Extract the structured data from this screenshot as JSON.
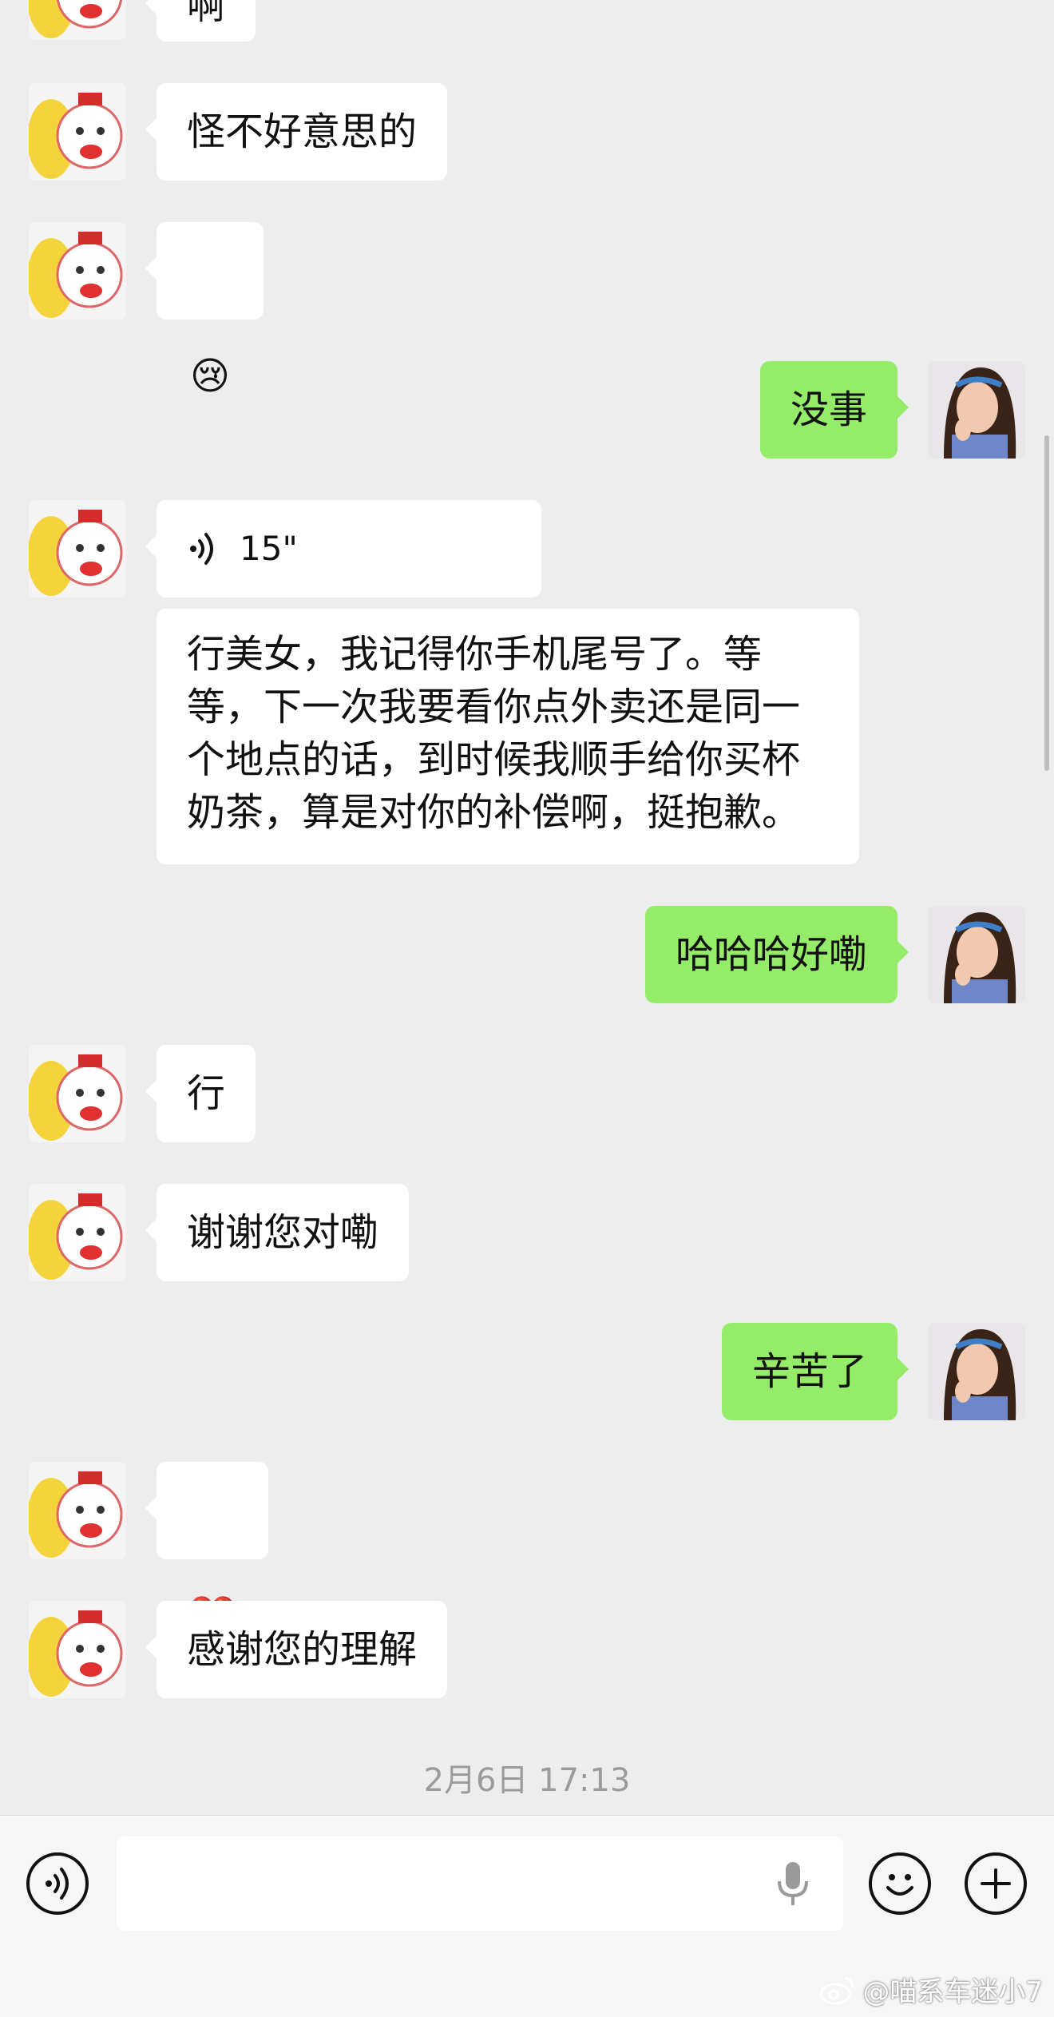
{
  "messages": [
    {
      "side": "left",
      "text": "啊"
    },
    {
      "side": "left",
      "text": "怪不好意思的"
    },
    {
      "side": "left",
      "emoji": "😢",
      "emoji_name": "crying-face"
    },
    {
      "side": "right",
      "text": "没事"
    },
    {
      "side": "left",
      "voice_duration": "15\""
    },
    {
      "side": "left",
      "text": "行美女，我记得你手机尾号了。等\n等，下一次我要看你点外卖还是同一\n个地点的话，到时候我顺手给你买杯\n奶茶，算是对你的补偿啊，挺抱歉。"
    },
    {
      "side": "right",
      "text": "哈哈哈好嘞"
    },
    {
      "side": "left",
      "text": "行"
    },
    {
      "side": "left",
      "text": "谢谢您对嘞"
    },
    {
      "side": "right",
      "text": "辛苦了"
    },
    {
      "side": "left",
      "emoji": "❤️",
      "emoji_name": "red-heart"
    },
    {
      "side": "left",
      "text": "感谢您的理解"
    }
  ],
  "timestamp": "2月6日 17:13",
  "input_bar": {
    "voice_icon": "voice-toggle-icon",
    "mic_icon": "microphone-icon",
    "emoji_icon": "smiley-icon",
    "plus_icon": "plus-icon"
  },
  "watermark": "@喵系车迷小7",
  "colors": {
    "background": "#ededed",
    "my_bubble": "#95ec69",
    "their_bubble": "#ffffff",
    "timestamp": "#9b9b9b"
  }
}
